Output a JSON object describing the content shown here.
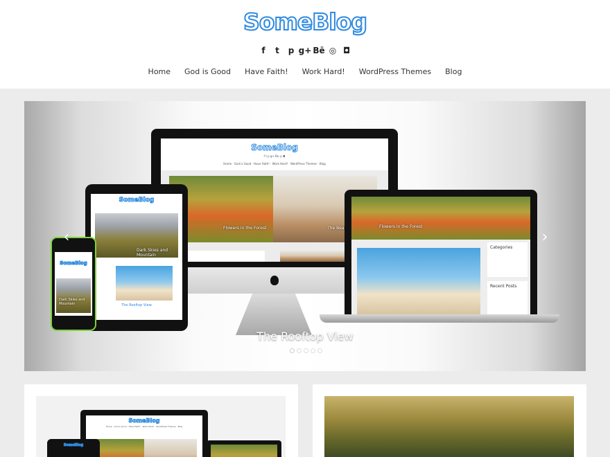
{
  "site": {
    "title": "SomeBlog"
  },
  "social": [
    {
      "name": "facebook-icon",
      "glyph": "f"
    },
    {
      "name": "twitter-icon",
      "glyph": "t"
    },
    {
      "name": "pinterest-icon",
      "glyph": "p"
    },
    {
      "name": "google-plus-icon",
      "glyph": "g+"
    },
    {
      "name": "behance-icon",
      "glyph": "Bē"
    },
    {
      "name": "dribbble-icon",
      "glyph": "◎"
    },
    {
      "name": "instagram-icon",
      "glyph": "◘"
    }
  ],
  "nav": [
    "Home",
    "God is Good",
    "Have Faith!",
    "Work Hard!",
    "WordPress Themes",
    "Blog"
  ],
  "slider": {
    "caption": "The Rooftop View",
    "dots": 5,
    "active_dot": 1,
    "arrow_left": "‹",
    "arrow_right": "›"
  },
  "mockup": {
    "logo": "SomeBlog",
    "nav": "Home · God is Good · Have Faith! · Work Hard! · WordPress Themes · Blog",
    "slide_captions": [
      "Flowers in the Forest",
      "The Beautiful Desert",
      "Dark Skies and Mountain",
      "The Rooftop View"
    ],
    "sidebar_titles": [
      "Categories",
      "Recent Posts"
    ]
  },
  "colors": {
    "brand": "#2e8ae0",
    "phone_frame": "#7cd33a"
  }
}
